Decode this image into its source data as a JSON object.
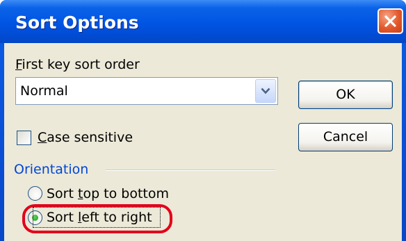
{
  "window": {
    "title": "Sort Options",
    "close_icon": "close-icon",
    "colors": {
      "titlebar": "#0054e3",
      "client": "#ece9d8",
      "close": "#e2582a",
      "highlight": "#e3001a"
    }
  },
  "first_key": {
    "label_accel": "F",
    "label_rest": "irst key sort order",
    "value": "Normal",
    "arrow_icon": "chevron-down-icon"
  },
  "buttons": {
    "ok": "OK",
    "cancel": "Cancel"
  },
  "case_sensitive": {
    "label_accel": "C",
    "label_rest": "ase sensitive",
    "checked": false
  },
  "orientation": {
    "title": "Orientation",
    "options": [
      {
        "pre": "Sort ",
        "accel": "t",
        "post": "op to bottom",
        "selected": false
      },
      {
        "pre": "Sort ",
        "accel": "l",
        "post": "eft to right",
        "selected": true
      }
    ]
  }
}
